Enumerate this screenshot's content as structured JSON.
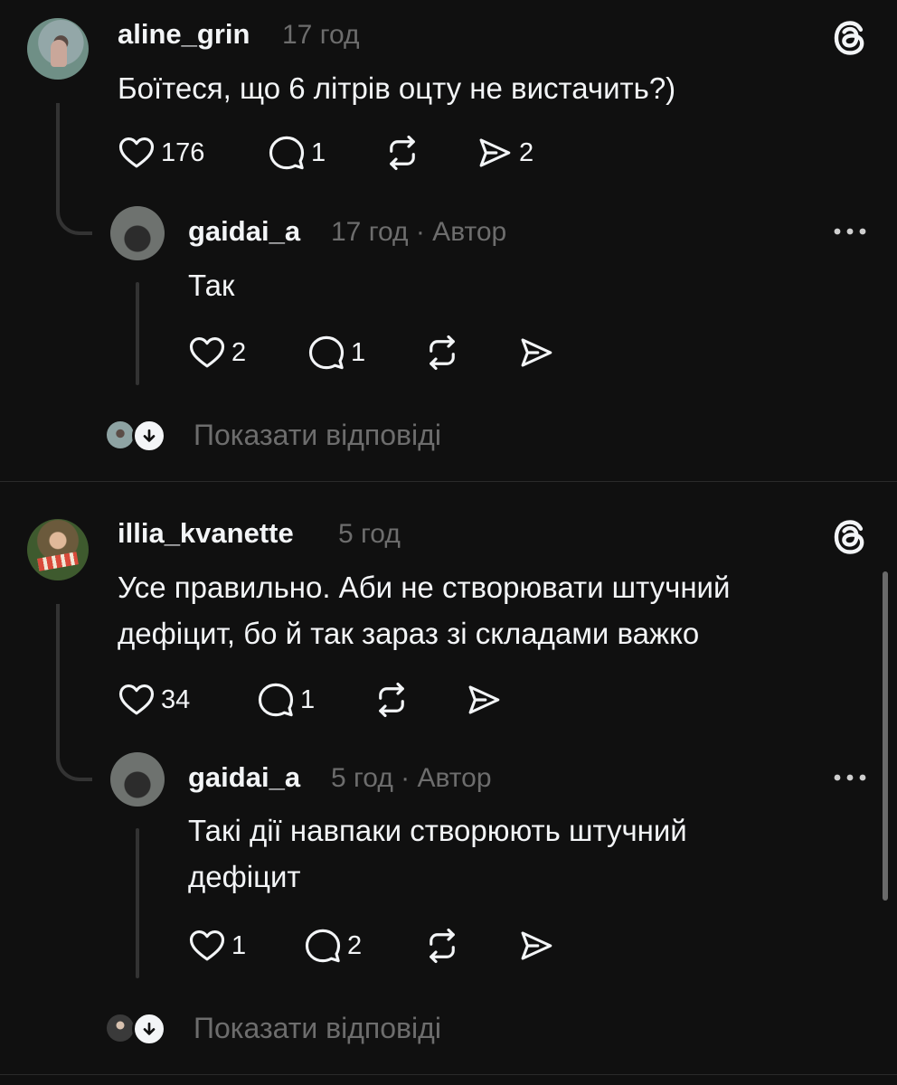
{
  "thread1": {
    "comment": {
      "username": "aline_grin",
      "time": "17 год",
      "text": "Боїтеся, що 6 літрів оцту не вистачить?)",
      "likes": "176",
      "replies": "1",
      "shares": "2"
    },
    "reply": {
      "username": "gaidai_a",
      "meta": "17 год · Автор",
      "text": "Так",
      "likes": "2",
      "replies": "1"
    },
    "show_replies": "Показати відповіді"
  },
  "thread2": {
    "comment": {
      "username": "illia_kvanette",
      "time": "5 год",
      "text_line1": "Усе правильно. Аби не створювати штучний",
      "text_line2": "дефіцит, бо й так зараз зі складами важко",
      "likes": "34",
      "replies": "1"
    },
    "reply": {
      "username": "gaidai_a",
      "meta": "5 год · Автор",
      "text_line1": "Такі дії навпаки створюють штучний",
      "text_line2": "дефіцит",
      "likes": "1",
      "replies": "2"
    },
    "show_replies": "Показати відповіді"
  },
  "icons": {
    "like": "heart-icon",
    "reply": "speech-bubble-icon",
    "repost": "repost-icon",
    "share": "send-icon",
    "threads": "threads-logo-icon",
    "more": "more-dots-icon"
  },
  "colors": {
    "background": "#101010",
    "text": "#f3f5f7",
    "muted": "#6d6d6d",
    "thread_line": "#333333"
  }
}
